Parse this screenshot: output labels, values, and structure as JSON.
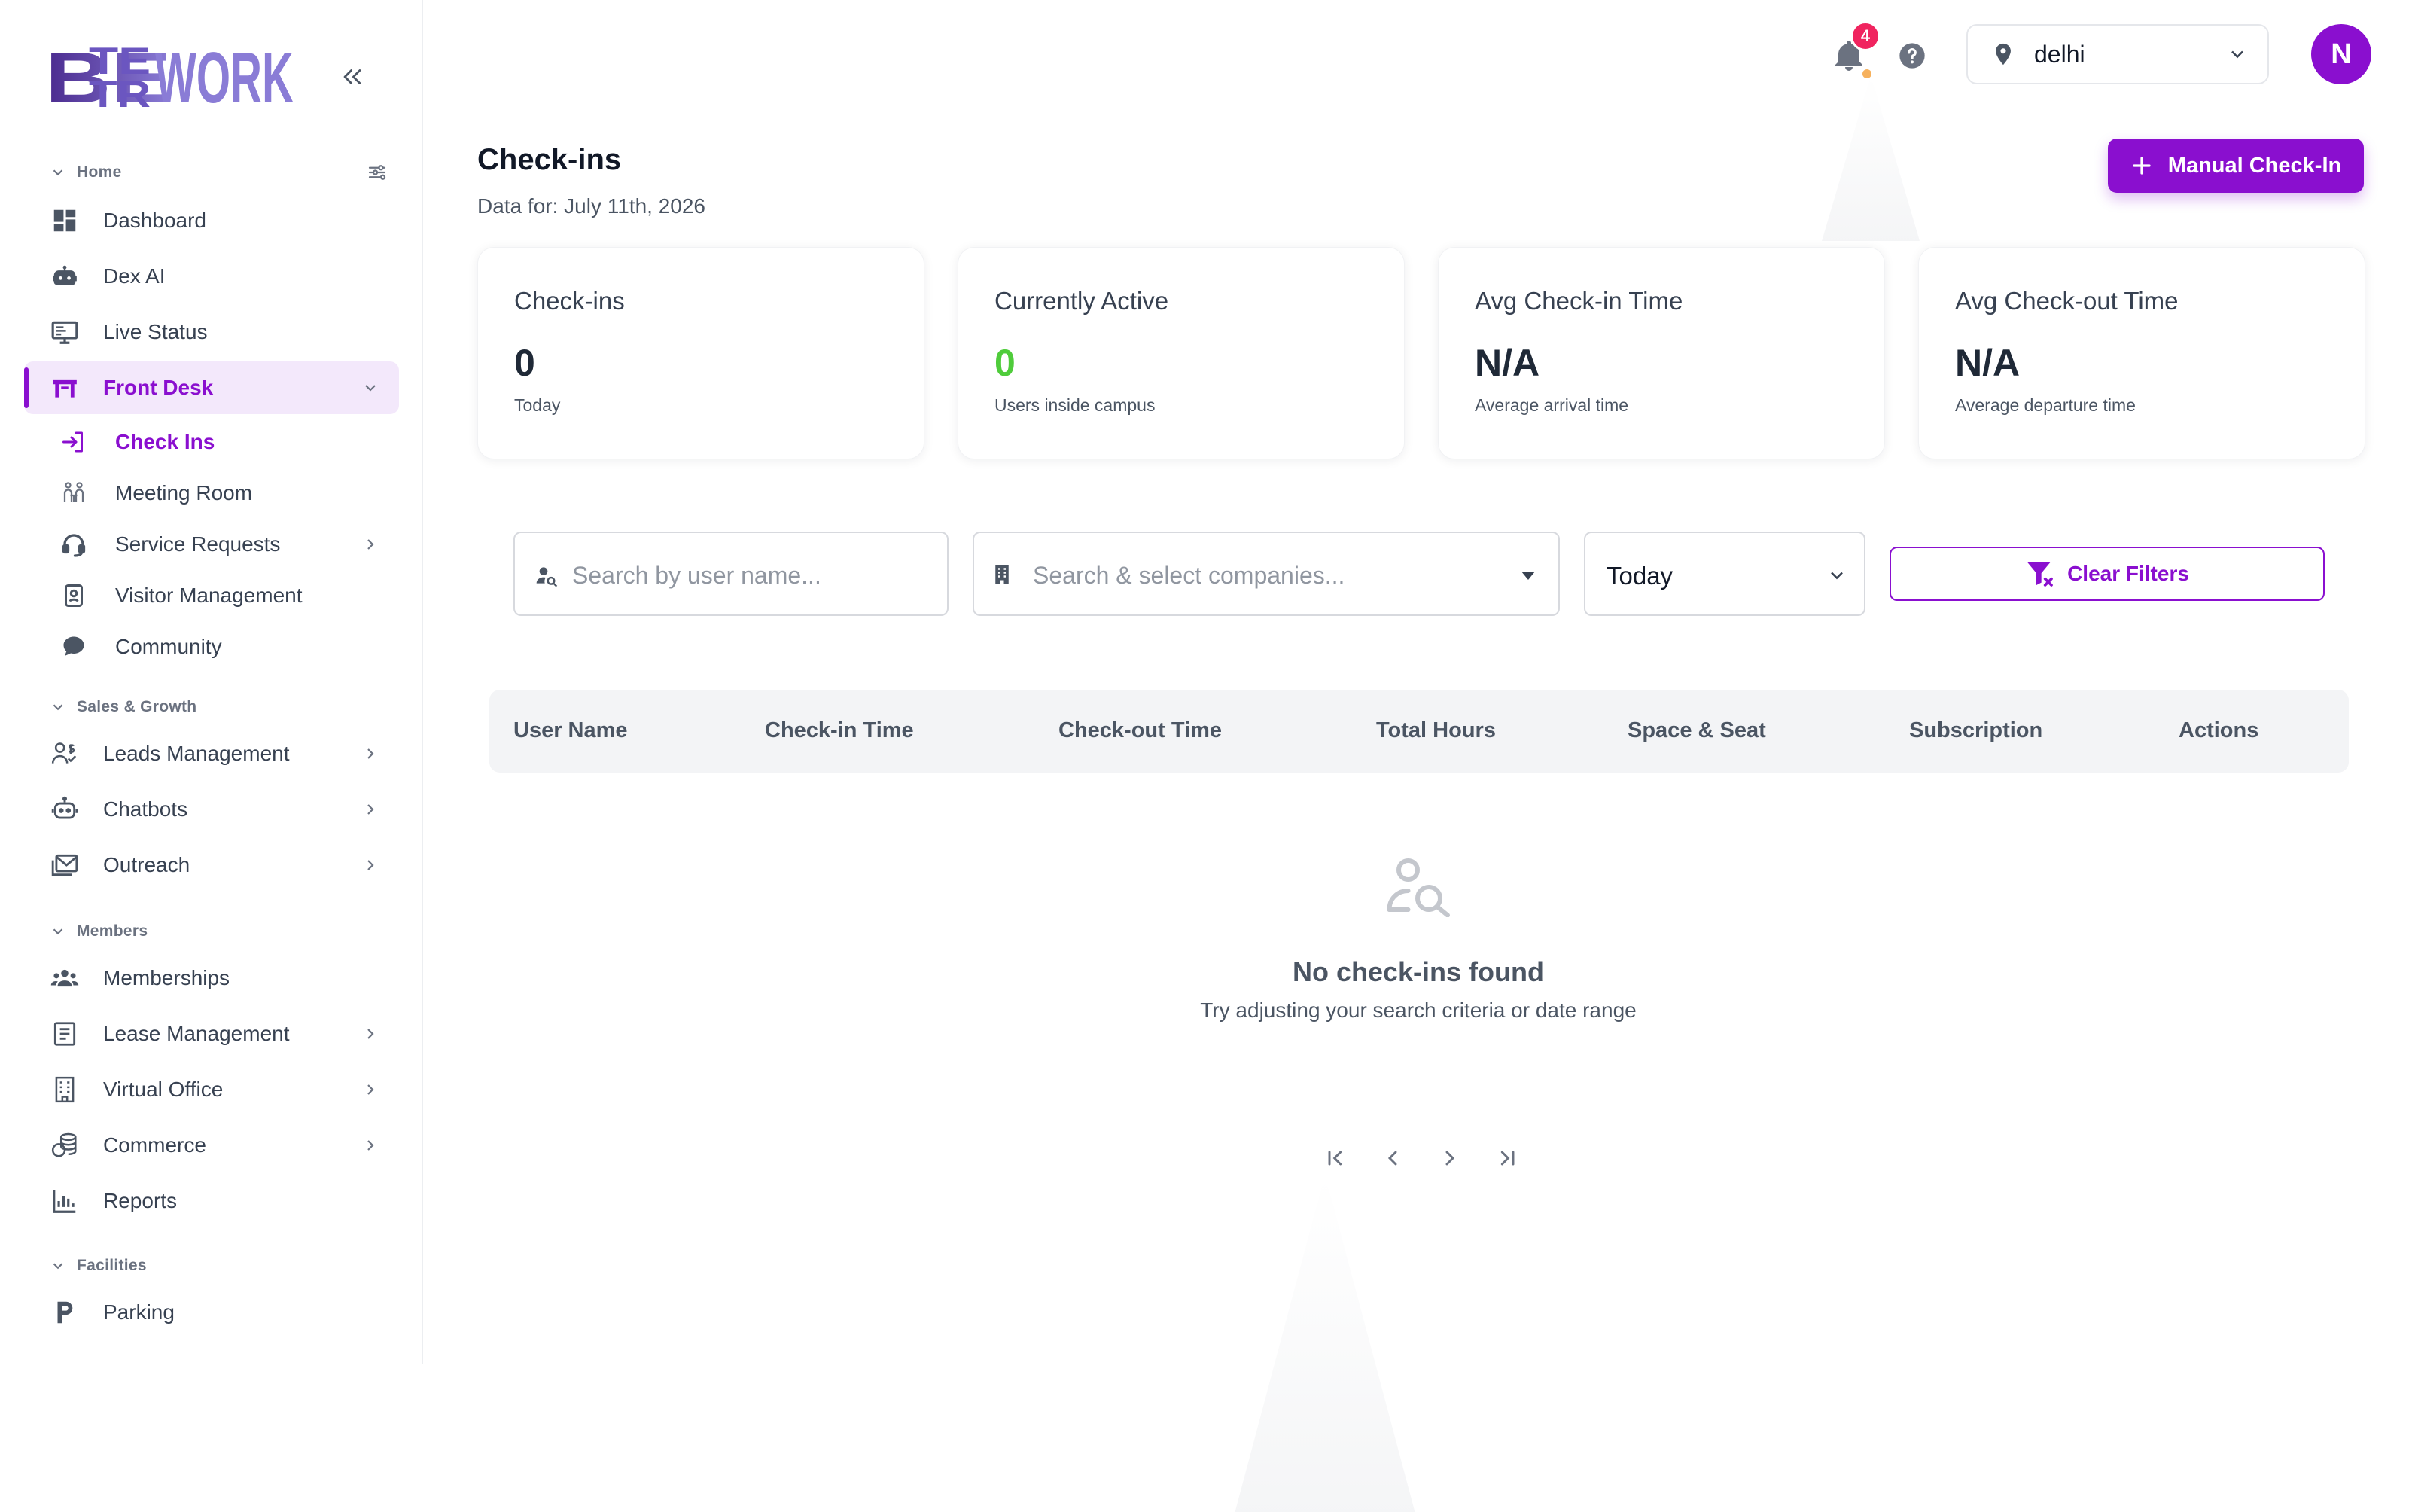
{
  "brand": {
    "logo_text": "BETTERWORK",
    "accent": "#8a0fcf"
  },
  "sidebar": {
    "sections": [
      {
        "label": "Home"
      },
      {
        "label": "Sales & Growth"
      },
      {
        "label": "Members"
      },
      {
        "label": "Facilities"
      }
    ],
    "items": {
      "dashboard": "Dashboard",
      "dex_ai": "Dex AI",
      "live_status": "Live Status",
      "front_desk": "Front Desk",
      "check_ins": "Check Ins",
      "meeting_room": "Meeting Room",
      "service_requests": "Service Requests",
      "visitor_management": "Visitor Management",
      "community": "Community",
      "leads_management": "Leads Management",
      "chatbots": "Chatbots",
      "outreach": "Outreach",
      "memberships": "Memberships",
      "lease_management": "Lease Management",
      "virtual_office": "Virtual Office",
      "commerce": "Commerce",
      "reports": "Reports",
      "parking": "Parking"
    }
  },
  "topbar": {
    "notification_count": "4",
    "location": "delhi",
    "avatar_initial": "N"
  },
  "page": {
    "title": "Check-ins",
    "subtitle": "Data for: July 11th, 2026",
    "primary_action": "Manual Check-In"
  },
  "stats": [
    {
      "title": "Check-ins",
      "value": "0",
      "desc": "Today"
    },
    {
      "title": "Currently Active",
      "value": "0",
      "desc": "Users inside campus",
      "color": "#4fcc3b"
    },
    {
      "title": "Avg Check-in Time",
      "value": "N/A",
      "desc": "Average arrival time"
    },
    {
      "title": "Avg Check-out Time",
      "value": "N/A",
      "desc": "Average departure time"
    }
  ],
  "filters": {
    "user_search_placeholder": "Search by user name...",
    "company_search_placeholder": "Search & select companies...",
    "date_range": "Today",
    "clear_label": "Clear Filters"
  },
  "table": {
    "columns": [
      "User Name",
      "Check-in Time",
      "Check-out Time",
      "Total Hours",
      "Space & Seat",
      "Subscription",
      "Actions"
    ],
    "rows": []
  },
  "empty_state": {
    "title": "No check-ins found",
    "message": "Try adjusting your search criteria or date range"
  }
}
